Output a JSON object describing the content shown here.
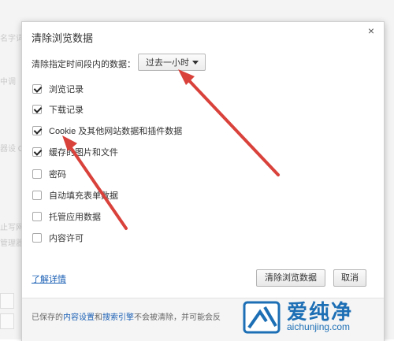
{
  "background": {
    "fragments": [
      "名字词",
      "中调",
      "器设 G",
      "止写网",
      "管理器"
    ]
  },
  "dialog": {
    "title": "清除浏览数据",
    "close_glyph": "×",
    "range_label": "清除指定时间段内的数据：",
    "range_value": "过去一小时",
    "options": [
      {
        "label": "浏览记录",
        "checked": true
      },
      {
        "label": "下载记录",
        "checked": true
      },
      {
        "label": "Cookie 及其他网站数据和插件数据",
        "checked": true
      },
      {
        "label": "缓存的图片和文件",
        "checked": true
      },
      {
        "label": "密码",
        "checked": false
      },
      {
        "label": "自动填充表单数据",
        "checked": false
      },
      {
        "label": "托管应用数据",
        "checked": false
      },
      {
        "label": "内容许可",
        "checked": false
      }
    ],
    "learn_more": "了解详情",
    "clear_button": "清除浏览数据",
    "cancel_button": "取消",
    "footer": {
      "prefix": "已保存的",
      "link1": "内容设置",
      "mid": "和",
      "link2": "搜索引擎",
      "suffix": "不会被清除，并可能会反"
    }
  },
  "annotation": {
    "arrow_color": "#d9413b"
  },
  "watermark": {
    "brand": "爱纯净",
    "url": "aichunjing.com"
  }
}
